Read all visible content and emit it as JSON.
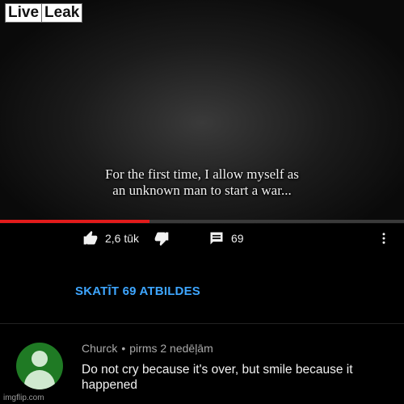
{
  "video": {
    "watermark_live": "Live",
    "watermark_leak": "Leak",
    "caption_line1": "For the first time, I allow myself as",
    "caption_line2": "an unknown man to start a war...",
    "progress": 0.37,
    "progress_color": "#e21b1b"
  },
  "actions": {
    "like_count": "2,6 tūk",
    "reply_count": "69",
    "like_icon": "thumbs-up-icon",
    "dislike_icon": "thumbs-down-icon",
    "reply_icon": "comment-icon",
    "more_icon": "more-vertical-icon"
  },
  "view_replies_label": "SKATĪT 69 ATBILDES",
  "comment": {
    "author": "Churck",
    "separator": "•",
    "time": "pirms 2 nedēļām",
    "text": "Do not cry because it's over, but smile because it happened",
    "avatar_color": "#1f7a24"
  },
  "watermark_footer": "imgflip.com",
  "accent_link": "#3ea6ff"
}
